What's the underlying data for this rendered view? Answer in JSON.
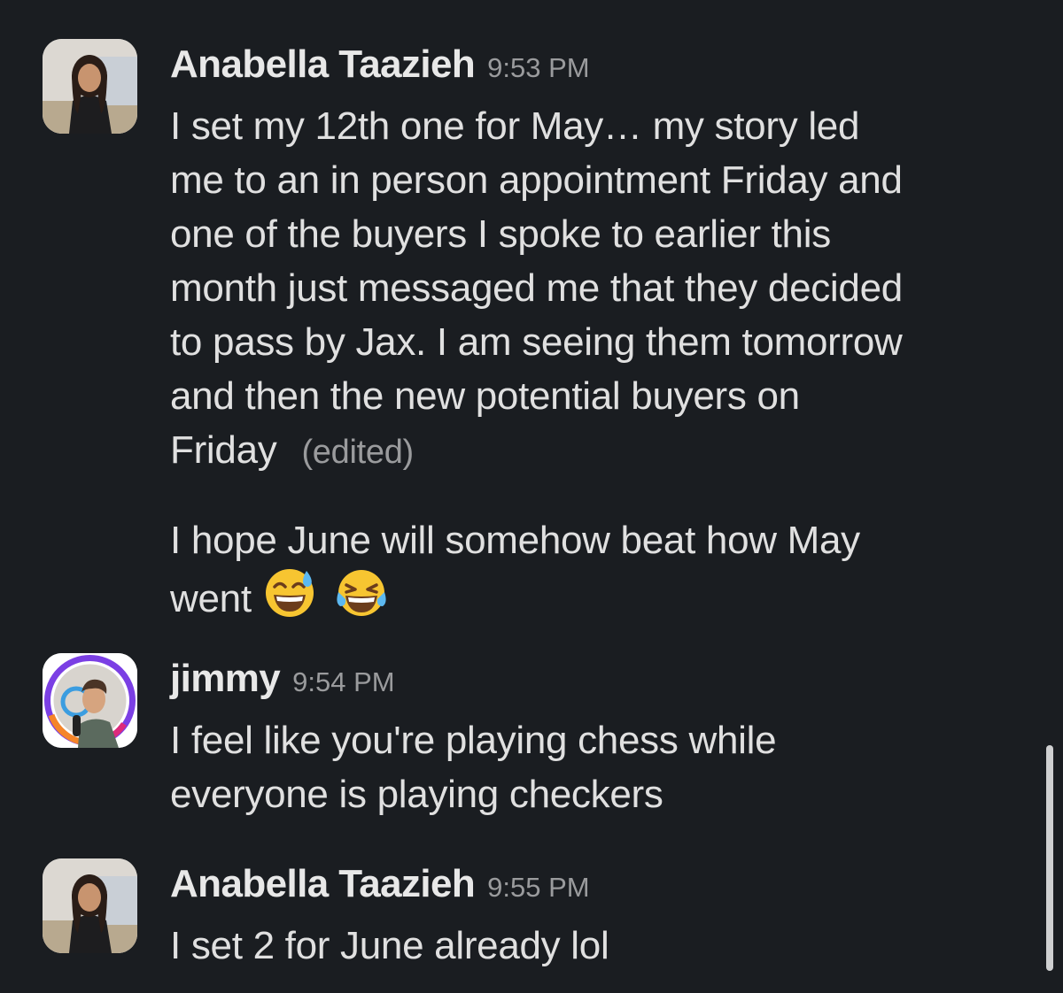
{
  "messages": [
    {
      "author": "Anabella Taazieh",
      "time": "9:53 PM",
      "lines": [
        "I set my 12th one for May… my story led",
        "me to an in person appointment Friday and",
        "one of the buyers I spoke to earlier this",
        "month just messaged me that they decided",
        "to pass by Jax. I am seeing them tomorrow",
        "and then the new potential buyers on",
        "Friday"
      ],
      "edited_label": "(edited)",
      "followup_lines": [
        "I hope June will somehow beat how May",
        "went"
      ],
      "emojis": [
        "grinning-sweat-emoji",
        "tears-of-joy-emoji"
      ]
    },
    {
      "author": "jimmy",
      "time": "9:54 PM",
      "lines": [
        "I feel like you're playing chess while",
        "everyone is playing checkers"
      ]
    },
    {
      "author": "Anabella Taazieh",
      "time": "9:55 PM",
      "lines": [
        "I set 2 for June already lol"
      ]
    }
  ],
  "colors": {
    "background": "#1a1d21",
    "text": "#e0e0e0",
    "muted": "#9a9b9d"
  }
}
